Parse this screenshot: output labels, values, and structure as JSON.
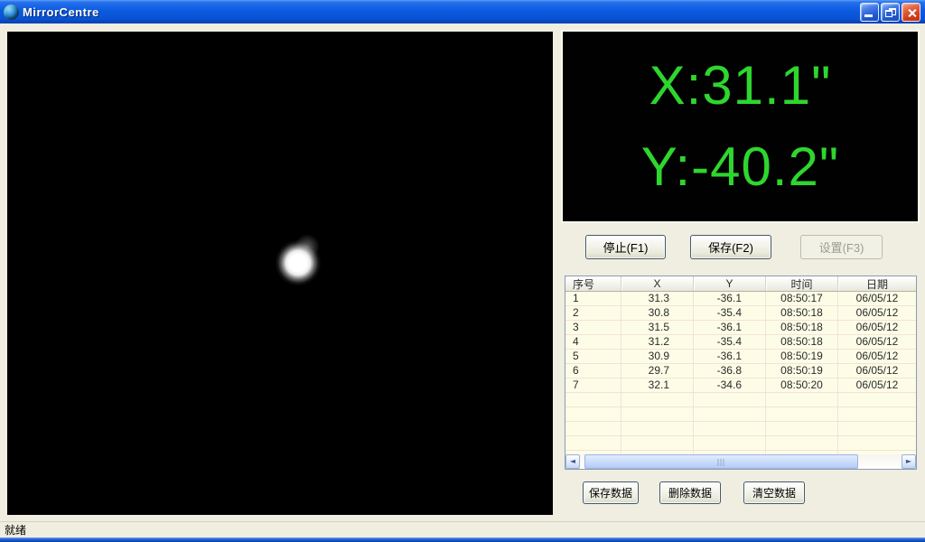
{
  "window": {
    "title": "MirrorCentre",
    "status": "就绪"
  },
  "coordinate_display": {
    "x_readout": "X:31.1\"",
    "y_readout": "Y:-40.2\""
  },
  "control_buttons": {
    "stop": "停止(F1)",
    "save": "保存(F2)",
    "settings": "设置(F3)",
    "settings_enabled": false
  },
  "data_buttons": {
    "save_data": "保存数据",
    "delete_data": "删除数据",
    "clear_data": "清空数据"
  },
  "table": {
    "columns": [
      "序号",
      "X",
      "Y",
      "时间",
      "日期"
    ],
    "rows": [
      [
        "1",
        "31.3",
        "-36.1",
        "08:50:17",
        "06/05/12"
      ],
      [
        "2",
        "30.8",
        "-35.4",
        "08:50:18",
        "06/05/12"
      ],
      [
        "3",
        "31.5",
        "-36.1",
        "08:50:18",
        "06/05/12"
      ],
      [
        "4",
        "31.2",
        "-35.4",
        "08:50:18",
        "06/05/12"
      ],
      [
        "5",
        "30.9",
        "-36.1",
        "08:50:19",
        "06/05/12"
      ],
      [
        "6",
        "29.7",
        "-36.8",
        "08:50:19",
        "06/05/12"
      ],
      [
        "7",
        "32.1",
        "-34.6",
        "08:50:20",
        "06/05/12"
      ]
    ],
    "empty_row_count": 5
  },
  "scrollbar": {
    "left_arrow": "◄",
    "right_arrow": "►"
  },
  "colors": {
    "readout_green": "#2ED62E",
    "titlebar_blue": "#0C5AE0",
    "table_background": "#FDFDE7",
    "client_background": "#EFEEE0"
  }
}
